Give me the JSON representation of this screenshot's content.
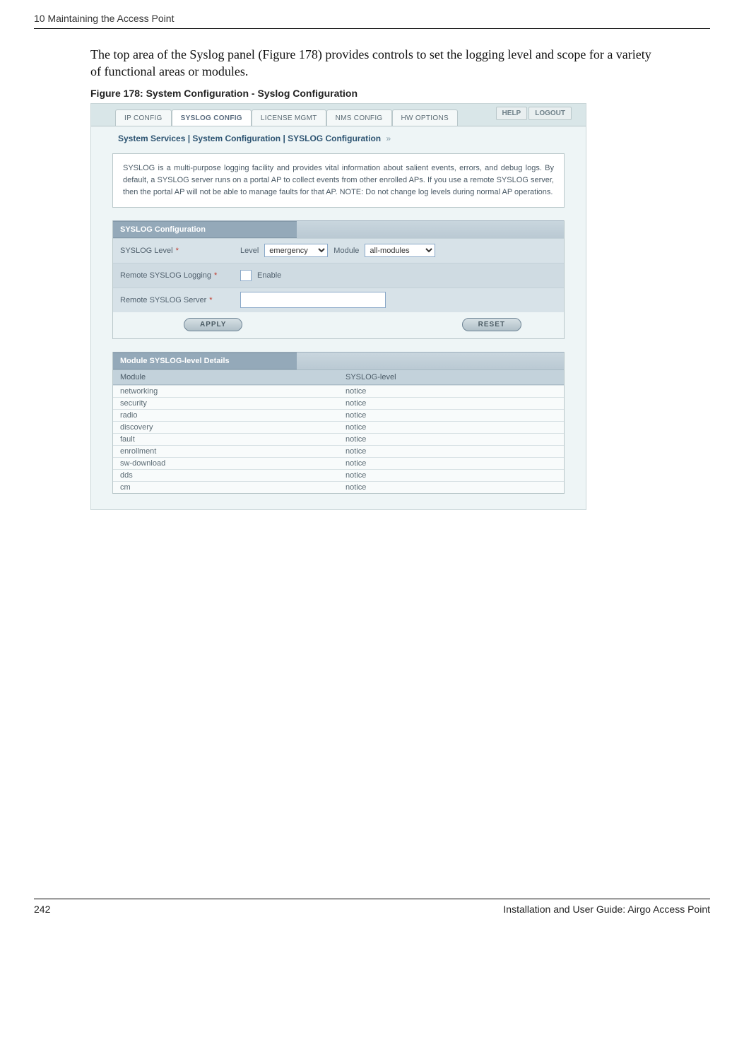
{
  "header": {
    "chapter": "10  Maintaining the Access Point"
  },
  "body_text": "The top area of the Syslog panel (Figure 178) provides controls to set the logging level and scope for a variety of functional areas or modules.",
  "figure_caption": "Figure 178:    System Configuration - Syslog Configuration",
  "tabs": {
    "items": [
      "IP CONFIG",
      "SYSLOG CONFIG",
      "LICENSE MGMT",
      "NMS CONFIG",
      "HW OPTIONS"
    ],
    "active_index": 1,
    "help": "HELP",
    "logout": "LOGOUT"
  },
  "breadcrumb": "System Services | System Configuration | SYSLOG Configuration",
  "infobox": "SYSLOG is a multi-purpose logging facility and provides vital information about salient events, errors, and debug logs. By default, a SYSLOG server runs on a portal AP to collect events from other enrolled APs. If you use a remote SYSLOG server, then the portal AP will not be able to manage faults for that AP. NOTE: Do not change log levels during normal AP operations.",
  "config": {
    "panel_title": "SYSLOG Configuration",
    "row1_label": "SYSLOG Level",
    "row1_level_label": "Level",
    "row1_level_value": "emergency",
    "row1_module_label": "Module",
    "row1_module_value": "all-modules",
    "row2_label": "Remote SYSLOG Logging",
    "row2_enable": "Enable",
    "row3_label": "Remote SYSLOG Server",
    "row3_value": "",
    "apply": "APPLY",
    "reset": "RESET"
  },
  "module_table": {
    "panel_title": "Module SYSLOG-level Details",
    "headers": [
      "Module",
      "SYSLOG-level"
    ],
    "rows": [
      {
        "module": "networking",
        "level": "notice"
      },
      {
        "module": "security",
        "level": "notice"
      },
      {
        "module": "radio",
        "level": "notice"
      },
      {
        "module": "discovery",
        "level": "notice"
      },
      {
        "module": "fault",
        "level": "notice"
      },
      {
        "module": "enrollment",
        "level": "notice"
      },
      {
        "module": "sw-download",
        "level": "notice"
      },
      {
        "module": "dds",
        "level": "notice"
      },
      {
        "module": "cm",
        "level": "notice"
      }
    ]
  },
  "footer": {
    "page": "242",
    "title": "Installation and User Guide: Airgo Access Point"
  }
}
